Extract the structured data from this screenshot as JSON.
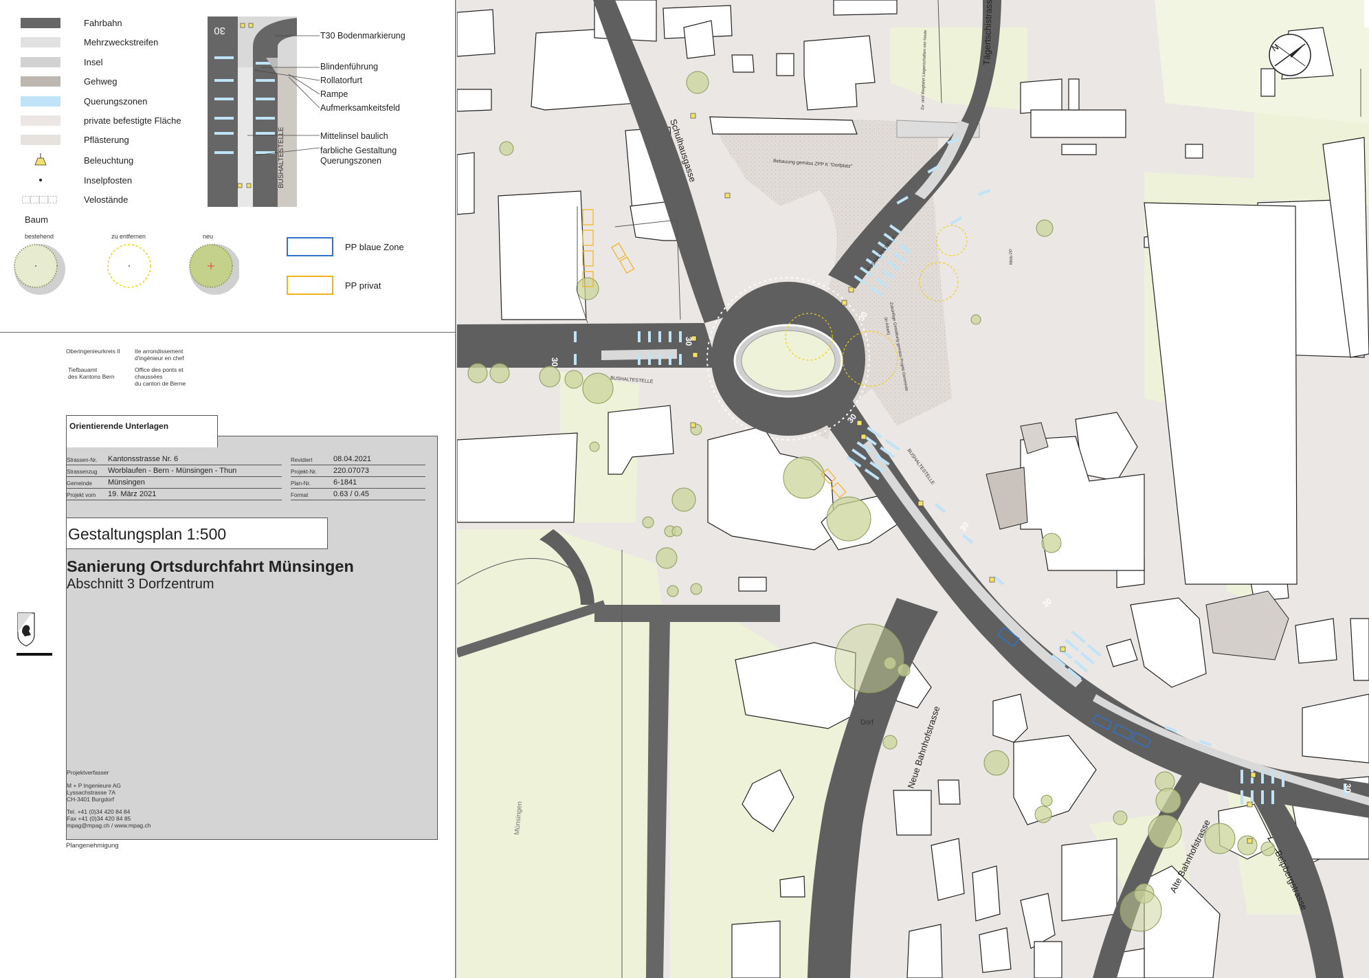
{
  "legend": {
    "items": [
      {
        "label": "Fahrbahn",
        "color": "#666666"
      },
      {
        "label": "Mehrzweckstreifen",
        "color": "#e1e1e1"
      },
      {
        "label": "Insel",
        "color": "#d2d2d2"
      },
      {
        "label": "Gehweg",
        "color": "#bdb6b1"
      },
      {
        "label": "Querungszonen",
        "color": "#bfe3f7"
      },
      {
        "label": "private befestigte Fläche",
        "color": "#ebe6e3"
      },
      {
        "label": "Pflästerung",
        "color": "#e8e2df"
      },
      {
        "label": "Beleuchtung",
        "color": "#f3e26a"
      },
      {
        "label": "Inselpfosten",
        "color": "#222222"
      },
      {
        "label": "Velostände",
        "color": "#ffffff"
      }
    ],
    "tree_title": "Baum",
    "tree_labels": [
      "bestehend",
      "zu entfernen",
      "neu"
    ],
    "pp": [
      {
        "label": "PP blaue Zone",
        "color": "#2f73c9"
      },
      {
        "label": "PP privat",
        "color": "#f2b21b"
      }
    ],
    "callouts": [
      "T30 Bodenmarkierung",
      "Blindenführung",
      "Rollatorfurt",
      "Rampe",
      "Aufmerksamkeitsfeld",
      "Mittelinsel baulich",
      "farbliche Gestaltung",
      "Querungszonen"
    ],
    "bus_label": "BUSHALTESTELLE",
    "t30": "30"
  },
  "authority": {
    "de1": "Oberingenieurkreis II",
    "fr1a": "IIe arrondissement",
    "fr1b": "d'ingénieur en chef",
    "de2a": "Tiefbauamt",
    "de2b": "des Kantons Bern",
    "fr2a": "Office des ponts et",
    "fr2b": "chaussées",
    "fr2c": "du canton de Berne"
  },
  "title": {
    "section": "Orientierende Unterlagen",
    "left_rows": [
      {
        "key": "Strassen-Nr.",
        "value": "Kantonsstrasse Nr. 6"
      },
      {
        "key": "Strassenzug",
        "value": "Worblaufen - Bern - Münsingen - Thun"
      },
      {
        "key": "Gemeinde",
        "value": "Münsingen"
      },
      {
        "key": "Projekt vom",
        "value": "19. März 2021"
      }
    ],
    "right_rows": [
      {
        "key": "Revidiert",
        "value": "08.04.2021"
      },
      {
        "key": "Projekt-Nr.",
        "value": "220.07073"
      },
      {
        "key": "Plan-Nr.",
        "value": "6-1841"
      },
      {
        "key": "Format",
        "value": "0.63 / 0.45"
      }
    ],
    "plan": "Gestaltungsplan 1:500",
    "project": "Sanierung Ortsdurchfahrt Münsingen",
    "subproject": "Abschnitt 3 Dorfzentrum",
    "author_head": "Projektverfasser",
    "author": [
      "M + P Ingenieure AG",
      "Lyssachstrasse 7A",
      "CH-3401 Burgdorf"
    ],
    "contact": [
      "Tel. +41 (0)34 420 84 84",
      "Fax +41 (0)34 420 84 85",
      "mpag@mpag.ch / www.mpag.ch"
    ],
    "approval": "Plangenehmigung"
  },
  "map": {
    "streets": {
      "schulhaus": "Schulhausgasse",
      "taegertschi": "Tägertschistrasse",
      "neue_bahnhof": "Neue Bahnhofstrasse",
      "alte_bahnhof": "Alte Bahnhofstrasse",
      "belp": "Belpbergstrasse"
    },
    "labels": {
      "dorf": "Dorf",
      "muensingen": "Münsingen",
      "bus": "BUSHALTESTELLE",
      "zpp": "Bebauung gemäss ZPP K \"Dorfplatz\"",
      "zukunft_a": "Zukünftige Gestaltung gemäss Projekt Gemeinde",
      "zukunft_b": "(in Arbeit)",
      "weg": "Zu- und Wegfahrt Liegenschaften wie heute",
      "moto": "Moto PP",
      "t30": "30",
      "north": "N"
    }
  }
}
